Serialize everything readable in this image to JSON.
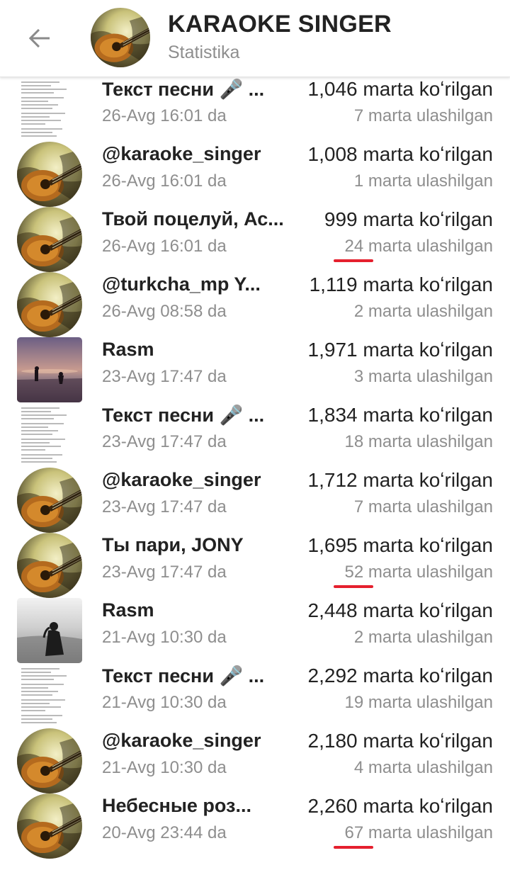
{
  "header": {
    "title": "KARAOKE SINGER",
    "subtitle": "Statistika",
    "back_icon": "arrow-back-icon"
  },
  "colors": {
    "accent_underline": "#e5202e",
    "muted_text": "#8e8e8e",
    "primary_text": "#222222"
  },
  "posts": [
    {
      "title": "Текст песни 🎤 ...",
      "date": "26-Avg 16:01 da",
      "views": "1,046 marta koʻrilgan",
      "shares": "7 marta ulashilgan",
      "thumb": "text-doc",
      "highlighted": false
    },
    {
      "title": "@karaoke_singer",
      "date": "26-Avg 16:01 da",
      "views": "1,008 marta koʻrilgan",
      "shares": "1 marta ulashilgan",
      "thumb": "guitar-avatar",
      "highlighted": false
    },
    {
      "title": "Твой поцелуй, Ас...",
      "date": "26-Avg 16:01 da",
      "views": "999 marta koʻrilgan",
      "shares": "24 marta ulashilgan",
      "thumb": "guitar-avatar",
      "highlighted": true
    },
    {
      "title": "@turkcha_mp Y...",
      "date": "26-Avg 08:58 da",
      "views": "1,119 marta koʻrilgan",
      "shares": "2 marta ulashilgan",
      "thumb": "guitar-avatar",
      "highlighted": false
    },
    {
      "title": "Rasm",
      "date": "23-Avg 17:47 da",
      "views": "1,971 marta koʻrilgan",
      "shares": "3 marta ulashilgan",
      "thumb": "sunset-photo",
      "highlighted": false
    },
    {
      "title": "Текст песни 🎤 ...",
      "date": "23-Avg 17:47 da",
      "views": "1,834 marta koʻrilgan",
      "shares": "18 marta ulashilgan",
      "thumb": "text-doc",
      "highlighted": false
    },
    {
      "title": "@karaoke_singer",
      "date": "23-Avg 17:47 da",
      "views": "1,712 marta koʻrilgan",
      "shares": "7 marta ulashilgan",
      "thumb": "guitar-avatar",
      "highlighted": false
    },
    {
      "title": "Ты пари, JONY",
      "date": "23-Avg 17:47 da",
      "views": "1,695 marta koʻrilgan",
      "shares": "52 marta ulashilgan",
      "thumb": "guitar-avatar",
      "highlighted": true
    },
    {
      "title": "Rasm",
      "date": "21-Avg 10:30 da",
      "views": "2,448 marta koʻrilgan",
      "shares": "2 marta ulashilgan",
      "thumb": "sea-photo",
      "highlighted": false
    },
    {
      "title": "Текст песни 🎤 ...",
      "date": "21-Avg 10:30 da",
      "views": "2,292 marta koʻrilgan",
      "shares": "19 marta ulashilgan",
      "thumb": "text-doc",
      "highlighted": false
    },
    {
      "title": "@karaoke_singer",
      "date": "21-Avg 10:30 da",
      "views": "2,180 marta koʻrilgan",
      "shares": "4 marta ulashilgan",
      "thumb": "guitar-avatar",
      "highlighted": false
    },
    {
      "title": "Небесные роз...",
      "date": "20-Avg 23:44 da",
      "views": "2,260 marta koʻrilgan",
      "shares": "67 marta ulashilgan",
      "thumb": "guitar-avatar",
      "highlighted": true
    }
  ]
}
